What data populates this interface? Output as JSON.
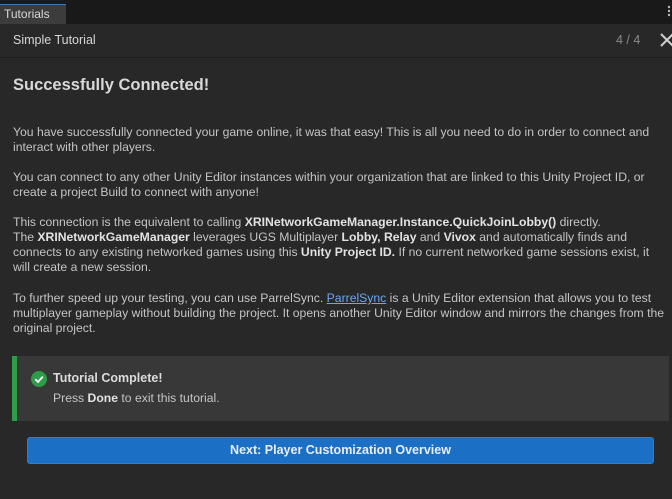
{
  "window": {
    "tab_label": "Tutorials",
    "menu_icon": "kebab-menu-icon"
  },
  "header": {
    "title": "Simple Tutorial",
    "page_counter": "4 / 4",
    "close_icon": "close-icon"
  },
  "content": {
    "heading": "Successfully Connected!",
    "p1": "You have successfully connected your game online, it was that easy! This is all you need to do in order to connect and interact with other players.",
    "p2": "You can connect to any other Unity Editor instances within your organization that are linked to this Unity Project ID, or create a project Build to connect with anyone!",
    "p3": {
      "s1": "This connection is the equivalent to calling ",
      "b1": "XRINetworkGameManager.Instance.QuickJoinLobby()",
      "s2": " directly.",
      "s3": "The ",
      "b2": "XRINetworkGameManager",
      "s4": " leverages UGS Multiplayer ",
      "b3": "Lobby, Relay",
      "s5": " and ",
      "b4": "Vivox",
      "s6": " and automatically finds and connects to any existing networked games using this ",
      "b5": "Unity Project ID.",
      "s7": " If no current networked game sessions exist, it will create a new session."
    },
    "p4": {
      "s1": "To further speed up your testing, you can use ParrelSync. ",
      "link": "ParrelSync",
      "s2": " is a Unity Editor extension that allows you to test multiplayer gameplay without building the project. It opens another Unity Editor window and mirrors the changes from the original project."
    }
  },
  "callout": {
    "title": "Tutorial Complete!",
    "body_pre": "Press ",
    "body_bold": "Done",
    "body_post": " to exit this tutorial.",
    "icon": "check-circle-icon",
    "accent_color": "#2f9c4a"
  },
  "footer": {
    "next_label": "Next: Player Customization Overview",
    "button_color": "#1b6fc4"
  }
}
